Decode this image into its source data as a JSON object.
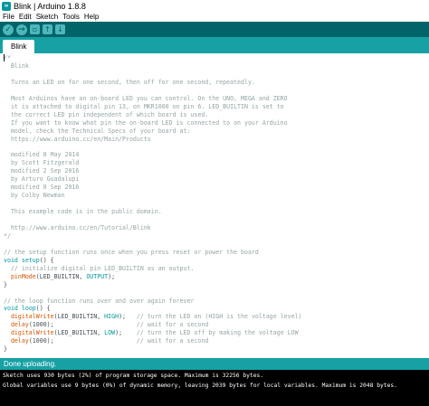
{
  "window": {
    "title": "Blink | Arduino 1.8.8",
    "icon_label": "∞"
  },
  "menu": [
    "File",
    "Edit",
    "Sketch",
    "Tools",
    "Help"
  ],
  "toolbar": {
    "verify_icon": "✓",
    "upload_icon": "→",
    "new_icon": "▫",
    "open_icon": "↑",
    "save_icon": "↓"
  },
  "tabs": [
    {
      "label": "Blink"
    }
  ],
  "code_lines": [
    [
      {
        "t": "c",
        "s": "/*"
      }
    ],
    [
      {
        "t": "c",
        "s": "  Blink"
      }
    ],
    [],
    [
      {
        "t": "c",
        "s": "  Turns an LED on for one second, then off for one second, repeatedly."
      }
    ],
    [],
    [
      {
        "t": "c",
        "s": "  Most Arduinos have an on-board LED you can control. On the UNO, MEGA and ZERO"
      }
    ],
    [
      {
        "t": "c",
        "s": "  it is attached to digital pin 13, on MKR1000 on pin 6. LED_BUILTIN is set to"
      }
    ],
    [
      {
        "t": "c",
        "s": "  the correct LED pin independent of which board is used."
      }
    ],
    [
      {
        "t": "c",
        "s": "  If you want to know what pin the on-board LED is connected to on your Arduino"
      }
    ],
    [
      {
        "t": "c",
        "s": "  model, check the Technical Specs of your board at:"
      }
    ],
    [
      {
        "t": "c",
        "s": "  https://www.arduino.cc/en/Main/Products"
      }
    ],
    [],
    [
      {
        "t": "c",
        "s": "  modified 8 May 2014"
      }
    ],
    [
      {
        "t": "c",
        "s": "  by Scott Fitzgerald"
      }
    ],
    [
      {
        "t": "c",
        "s": "  modified 2 Sep 2016"
      }
    ],
    [
      {
        "t": "c",
        "s": "  by Arturo Guadalupi"
      }
    ],
    [
      {
        "t": "c",
        "s": "  modified 8 Sep 2016"
      }
    ],
    [
      {
        "t": "c",
        "s": "  by Colby Newman"
      }
    ],
    [],
    [
      {
        "t": "c",
        "s": "  This example code is in the public domain."
      }
    ],
    [],
    [
      {
        "t": "c",
        "s": "  http://www.arduino.cc/en/Tutorial/Blink"
      }
    ],
    [
      {
        "t": "c",
        "s": "*/"
      }
    ],
    [],
    [
      {
        "t": "c",
        "s": "// the setup function runs once when you press reset or power the board"
      }
    ],
    [
      {
        "t": "k",
        "s": "void"
      },
      {
        "t": "p",
        "s": " "
      },
      {
        "t": "k",
        "s": "setup"
      },
      {
        "t": "p",
        "s": "() {"
      }
    ],
    [
      {
        "t": "c",
        "s": "  // initialize digital pin LED_BUILTIN as an output."
      }
    ],
    [
      {
        "t": "p",
        "s": "  "
      },
      {
        "t": "f",
        "s": "pinMode"
      },
      {
        "t": "p",
        "s": "(LED_BUILTIN, "
      },
      {
        "t": "k",
        "s": "OUTPUT"
      },
      {
        "t": "p",
        "s": ");"
      }
    ],
    [
      {
        "t": "p",
        "s": "}"
      }
    ],
    [],
    [
      {
        "t": "c",
        "s": "// the loop function runs over and over again forever"
      }
    ],
    [
      {
        "t": "k",
        "s": "void"
      },
      {
        "t": "p",
        "s": " "
      },
      {
        "t": "k",
        "s": "loop"
      },
      {
        "t": "p",
        "s": "() {"
      }
    ],
    [
      {
        "t": "p",
        "s": "  "
      },
      {
        "t": "f",
        "s": "digitalWrite"
      },
      {
        "t": "p",
        "s": "(LED_BUILTIN, "
      },
      {
        "t": "k",
        "s": "HIGH"
      },
      {
        "t": "p",
        "s": ");   "
      },
      {
        "t": "c",
        "s": "// turn the LED on (HIGH is the voltage level)"
      }
    ],
    [
      {
        "t": "p",
        "s": "  "
      },
      {
        "t": "f",
        "s": "delay"
      },
      {
        "t": "p",
        "s": "(1000);                       "
      },
      {
        "t": "c",
        "s": "// wait for a second"
      }
    ],
    [
      {
        "t": "p",
        "s": "  "
      },
      {
        "t": "f",
        "s": "digitalWrite"
      },
      {
        "t": "p",
        "s": "(LED_BUILTIN, "
      },
      {
        "t": "k",
        "s": "LOW"
      },
      {
        "t": "p",
        "s": ");    "
      },
      {
        "t": "c",
        "s": "// turn the LED off by making the voltage LOW"
      }
    ],
    [
      {
        "t": "p",
        "s": "  "
      },
      {
        "t": "f",
        "s": "delay"
      },
      {
        "t": "p",
        "s": "(1000);                       "
      },
      {
        "t": "c",
        "s": "// wait for a second"
      }
    ],
    [
      {
        "t": "p",
        "s": "}"
      }
    ]
  ],
  "status": {
    "message": "Done uploading."
  },
  "console": {
    "lines": [
      "Sketch uses 930 bytes (2%) of program storage space. Maximum is 32256 bytes.",
      "Global variables use 9 bytes (0%) of dynamic memory, leaving 2039 bytes for local variables. Maximum is 2048 bytes."
    ]
  },
  "colors": {
    "toolbar": "#006468",
    "tab_strip": "#17a1a5",
    "keyword": "#00979c",
    "function": "#d35400",
    "comment": "#95a5a6",
    "console_bg": "#000000"
  }
}
